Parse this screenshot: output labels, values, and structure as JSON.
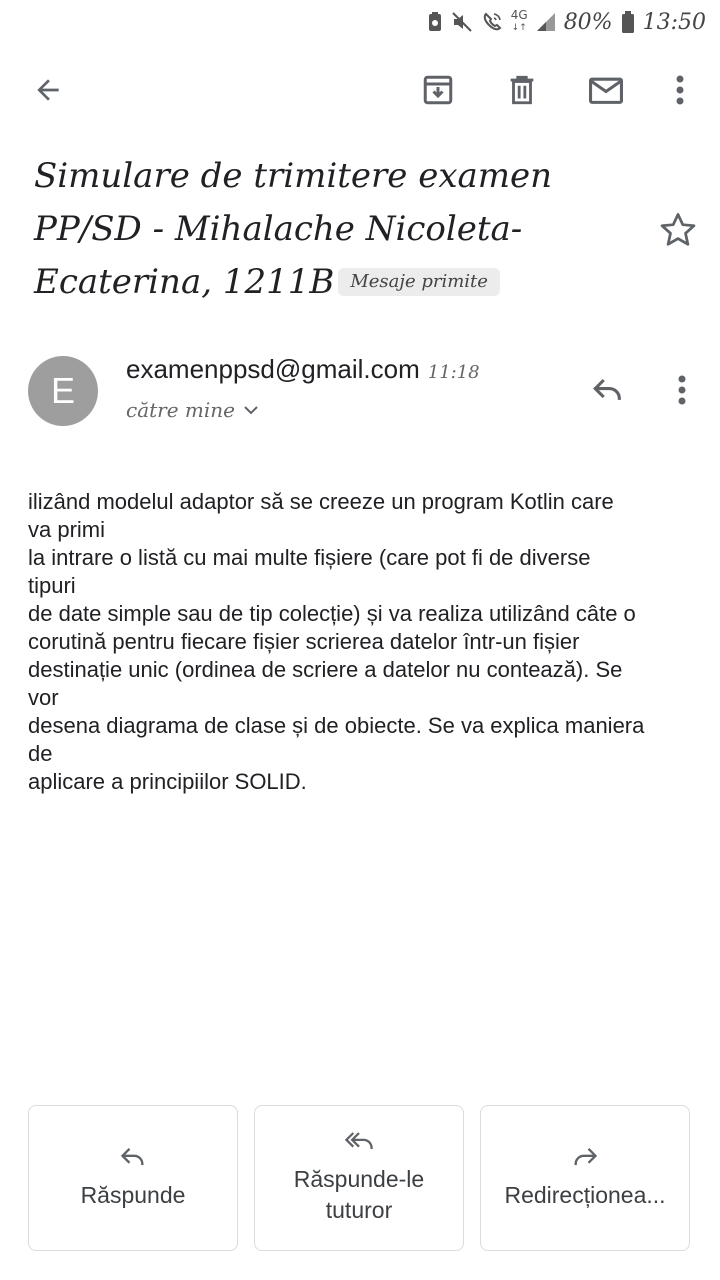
{
  "status_bar": {
    "network": "4G",
    "battery": "80%",
    "time": "13:50"
  },
  "toolbar": {
    "back": "arrow-back-icon",
    "archive": "archive-icon",
    "delete": "delete-icon",
    "mark_unread": "mail-icon",
    "more": "more-vert-icon"
  },
  "email": {
    "subject_lines": [
      "Simulare de trimitere examen",
      "PP/SD - Mihalache Nicoleta-",
      "Ecaterina, 1211B"
    ],
    "label": "Mesaje primite",
    "sender_initial": "E",
    "sender": "examenppsd@gmail.com",
    "time": "11:18",
    "recipients": "către mine",
    "body_lines": [
      "ilizând modelul adaptor să se creeze un program Kotlin care",
      "va primi",
      "la intrare o listă cu mai multe fișiere (care pot fi de diverse",
      "tipuri",
      "de date simple sau de tip colecție) și va realiza utilizând câte o",
      "corutină pentru fiecare fișier scrierea datelor într-un fișier",
      "destinație unic (ordinea de scriere a datelor nu contează). Se",
      "vor",
      "desena diagrama de clase și de obiecte. Se va explica maniera",
      "de",
      "aplicare a principiilor SOLID."
    ]
  },
  "actions": {
    "reply": "Răspunde",
    "reply_all_line1": "Răspunde-le",
    "reply_all_line2": "tuturor",
    "forward": "Redirecționea..."
  },
  "colors": {
    "icon": "#5f6368",
    "avatar": "#9e9e9e",
    "chip": "#ececec",
    "border": "#dadce0"
  }
}
